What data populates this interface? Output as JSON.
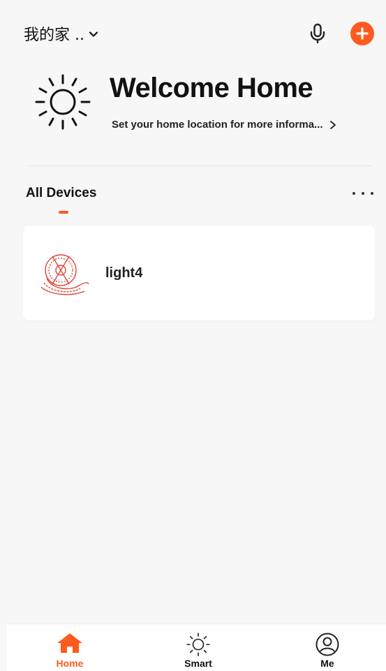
{
  "header": {
    "home_name": "我的家 ..",
    "mic_icon": "microphone-icon",
    "add_icon": "plus-icon",
    "accent_color": "#ff5a1f"
  },
  "welcome": {
    "title": "Welcome Home",
    "subtitle": "Set your home location for more informa...",
    "icon": "sun-icon"
  },
  "devices_tab": {
    "label": "All Devices",
    "more_icon": "more-dots-icon"
  },
  "devices": [
    {
      "name": "light4",
      "icon": "led-strip-icon"
    }
  ],
  "bottom_nav": [
    {
      "label": "Home",
      "icon": "home-icon",
      "active": true
    },
    {
      "label": "Smart",
      "icon": "sun-icon",
      "active": false
    },
    {
      "label": "Me",
      "icon": "user-icon",
      "active": false
    }
  ]
}
